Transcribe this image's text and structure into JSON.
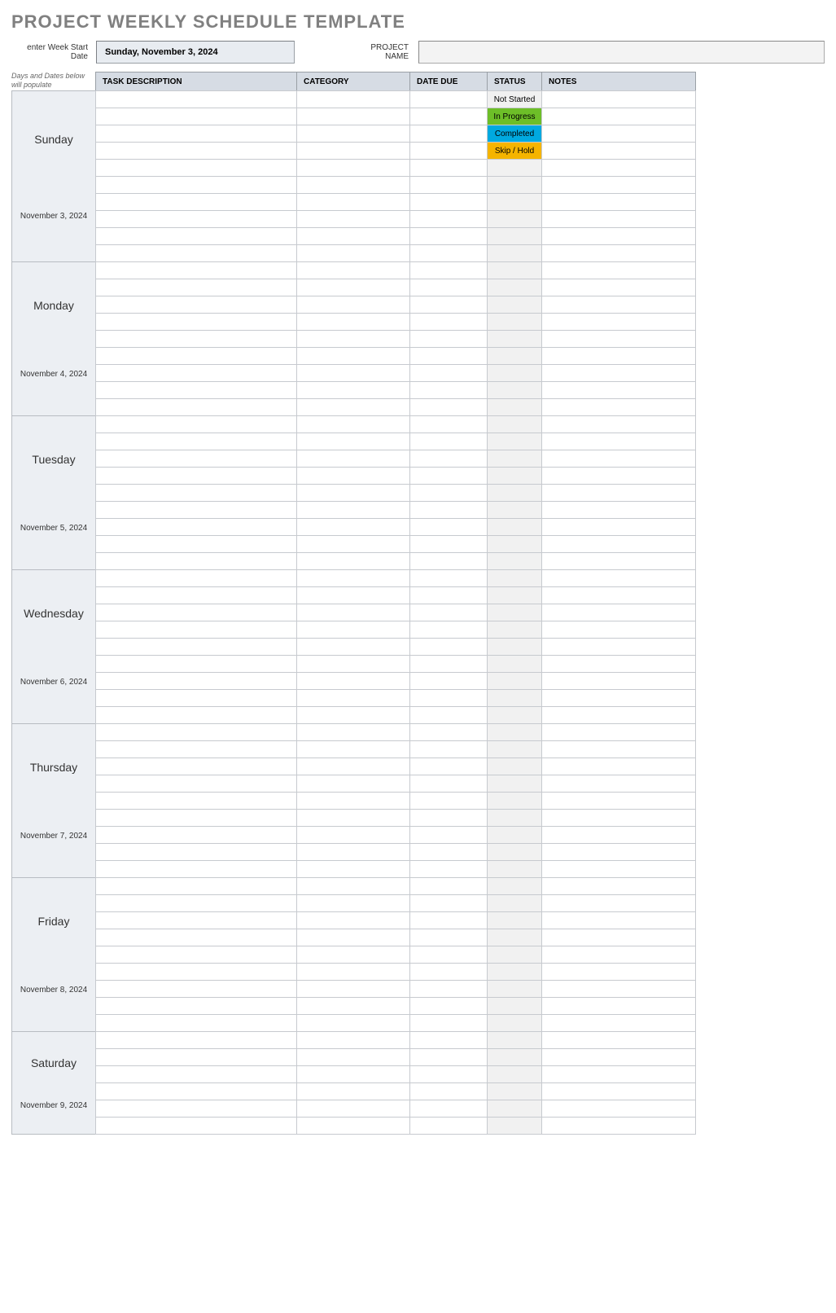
{
  "title": "PROJECT WEEKLY SCHEDULE TEMPLATE",
  "start_label": "enter Week Start Date",
  "start_date": "Sunday, November 3, 2024",
  "project_label": "PROJECT NAME",
  "header_help": "Days and Dates below will populate automatically",
  "headers": {
    "task": "TASK DESCRIPTION",
    "category": "CATEGORY",
    "date_due": "DATE DUE",
    "status": "STATUS",
    "notes": "NOTES"
  },
  "status_values": {
    "not_started": "Not Started",
    "in_progress": "In Progress",
    "completed": "Completed",
    "skip_hold": "Skip / Hold"
  },
  "days": [
    {
      "name": "Sunday",
      "date": "November 3, 2024",
      "rows": 10,
      "show_status_examples": true
    },
    {
      "name": "Monday",
      "date": "November 4, 2024",
      "rows": 9
    },
    {
      "name": "Tuesday",
      "date": "November 5, 2024",
      "rows": 9
    },
    {
      "name": "Wednesday",
      "date": "November 6, 2024",
      "rows": 9
    },
    {
      "name": "Thursday",
      "date": "November 7, 2024",
      "rows": 9
    },
    {
      "name": "Friday",
      "date": "November 8, 2024",
      "rows": 9
    },
    {
      "name": "Saturday",
      "date": "November 9, 2024",
      "rows": 6
    }
  ]
}
